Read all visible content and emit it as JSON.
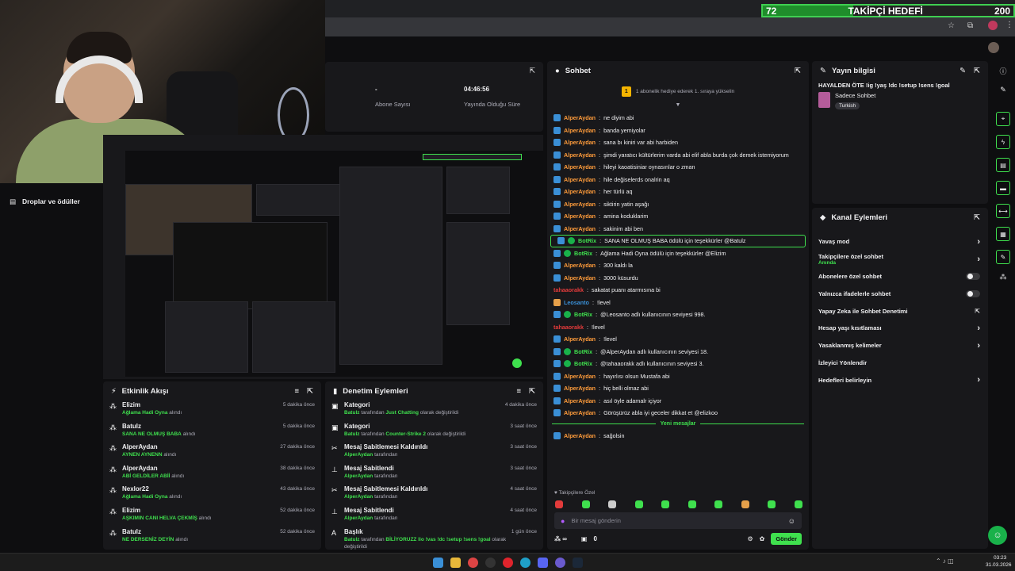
{
  "goal": {
    "current": "72",
    "title": "TAKİPÇİ HEDEFİ",
    "target": "200",
    "progress": 0.36
  },
  "left_nav": {
    "items": [
      {
        "label": "Droplar ve ödüller"
      }
    ]
  },
  "stats": {
    "items": [
      {
        "value": "-",
        "label": "Abone Sayısı"
      },
      {
        "value": "04:46:56",
        "label": "Yayında Olduğu Süre"
      }
    ]
  },
  "activity": {
    "title": "Etkinlik Akışı",
    "items": [
      {
        "name": "Elizim",
        "detail": "Ağlama Hadi Oyna",
        "suffix": "alındı",
        "time": "5 dakika önce"
      },
      {
        "name": "Batulz",
        "detail": "SANA NE OLMUŞ BABA",
        "suffix": "alındı",
        "time": "5 dakika önce"
      },
      {
        "name": "AlperAydan",
        "detail": "AYNEN AYNENN",
        "suffix": "alındı",
        "time": "27 dakika önce"
      },
      {
        "name": "AlperAydan",
        "detail": "ABİ GELDİLER ABİİ",
        "suffix": "alındı",
        "time": "38 dakika önce"
      },
      {
        "name": "Nexlor22",
        "detail": "Ağlama Hadi Oyna",
        "suffix": "alındı",
        "time": "43 dakika önce"
      },
      {
        "name": "Elizim",
        "detail": "AŞKIMIN CANI HELVA ÇEKMİŞ",
        "suffix": "alındı",
        "time": "52 dakika önce"
      },
      {
        "name": "Batulz",
        "detail": "NE DERSENİZ DEYİN",
        "suffix": "alındı",
        "time": "52 dakika önce"
      }
    ]
  },
  "moderation": {
    "title": "Denetim Eylemleri",
    "items": [
      {
        "name": "Kategori",
        "user": "Batulz",
        "mid": "tarafından",
        "detail": "Just Chatting",
        "suffix": "olarak değiştirildi",
        "time": "4 dakika önce",
        "icon": "category-icon"
      },
      {
        "name": "Kategori",
        "user": "Batulz",
        "mid": "tarafından",
        "detail": "Counter-Strike 2",
        "suffix": "olarak değiştirildi",
        "time": "3 saat önce",
        "icon": "category-icon"
      },
      {
        "name": "Mesaj Sabitlemesi Kaldırıldı",
        "user": "AlperAydan",
        "mid": "tarafından",
        "detail": "",
        "suffix": "",
        "time": "3 saat önce",
        "icon": "unpin-icon"
      },
      {
        "name": "Mesaj Sabitlendi",
        "user": "AlperAydan",
        "mid": "tarafından",
        "detail": "",
        "suffix": "",
        "time": "3 saat önce",
        "icon": "pin-icon"
      },
      {
        "name": "Mesaj Sabitlemesi Kaldırıldı",
        "user": "AlperAydan",
        "mid": "tarafından",
        "detail": "",
        "suffix": "",
        "time": "4 saat önce",
        "icon": "unpin-icon"
      },
      {
        "name": "Mesaj Sabitlendi",
        "user": "AlperAydan",
        "mid": "tarafından",
        "detail": "",
        "suffix": "",
        "time": "4 saat önce",
        "icon": "pin-icon"
      },
      {
        "name": "Başlık",
        "user": "Batulz",
        "mid": "tarafından",
        "detail": "BİLİYORUZZ lio !vas !dc !setup !sens !goal",
        "suffix": "olarak değiştirildi",
        "time": "1 gün önce",
        "icon": "title-icon"
      }
    ]
  },
  "chat": {
    "title": "Sohbet",
    "hype": "1 abonelik hediye ederek 1. sıraya yükselin",
    "hype_rank": "1",
    "messages": [
      {
        "user": "AlperAydan",
        "text": "ne diyim abi",
        "color": "#ff9c3b",
        "badge": "mod"
      },
      {
        "user": "AlperAydan",
        "text": "banda yemiyolar",
        "color": "#ff9c3b",
        "badge": "mod"
      },
      {
        "user": "AlperAydan",
        "text": "sana bı kiniri var abi harbiden",
        "color": "#ff9c3b",
        "badge": "mod"
      },
      {
        "user": "AlperAydan",
        "text": "şimdi yaratıcı kültürlerim varda abi elif abla burda çok demek istemiyorum",
        "color": "#ff9c3b",
        "badge": "mod"
      },
      {
        "user": "AlperAydan",
        "text": "hileyi kaoatisiniar oynasınlar o zman",
        "color": "#ff9c3b",
        "badge": "mod"
      },
      {
        "user": "AlperAydan",
        "text": "hile değiselerds onalrin aq",
        "color": "#ff9c3b",
        "badge": "mod"
      },
      {
        "user": "AlperAydan",
        "text": "her türlü aq",
        "color": "#ff9c3b",
        "badge": "mod"
      },
      {
        "user": "AlperAydan",
        "text": "siktirin yatin aşağı",
        "color": "#ff9c3b",
        "badge": "mod"
      },
      {
        "user": "AlperAydan",
        "text": "amina koduklarim",
        "color": "#ff9c3b",
        "badge": "mod"
      },
      {
        "user": "AlperAydan",
        "text": "sakinim abi ben",
        "color": "#ff9c3b",
        "badge": "mod"
      },
      {
        "user": "BotRix",
        "text": "SANA NE OLMUŞ BABA ödülü için teşekkürler @Batulz",
        "color": "#3fe04e",
        "badge": "bot",
        "highlight": true
      },
      {
        "user": "BotRix",
        "text": "Ağlama Hadi Oyna ödülü için teşekkürler @Elizim",
        "color": "#3fe04e",
        "badge": "bot"
      },
      {
        "user": "AlperAydan",
        "text": "300 kaldı la",
        "color": "#ff9c3b",
        "badge": "mod"
      },
      {
        "user": "AlperAydan",
        "text": "3000 küsurdu",
        "color": "#ff9c3b",
        "badge": "mod"
      },
      {
        "user": "tahaaorakk",
        "text": "sakatat puanı atarmısına bi",
        "color": "#e33b3b",
        "badge": ""
      },
      {
        "user": "Leosanto",
        "text": "!level",
        "color": "#3a8fd6",
        "badge": "crown"
      },
      {
        "user": "BotRix",
        "text": "@Leosanto adlı kullanıcının seviyesi 998.",
        "color": "#3fe04e",
        "badge": "bot"
      },
      {
        "user": "tahaaorakk",
        "text": "!level",
        "color": "#e33b3b",
        "badge": ""
      },
      {
        "user": "AlperAydan",
        "text": "!level",
        "color": "#ff9c3b",
        "badge": "mod"
      },
      {
        "user": "BotRix",
        "text": "@AlperAydan adlı kullanıcının seviyesi 18.",
        "color": "#3fe04e",
        "badge": "bot"
      },
      {
        "user": "BotRix",
        "text": "@tahaaorakk adlı kullanıcının seviyesi 3.",
        "color": "#3fe04e",
        "badge": "bot"
      },
      {
        "user": "AlperAydan",
        "text": "hayırlısı olsun Mustafa abi",
        "color": "#ff9c3b",
        "badge": "mod"
      },
      {
        "user": "AlperAydan",
        "text": "hiç belli olmaz abi",
        "color": "#ff9c3b",
        "badge": "mod"
      },
      {
        "user": "AlperAydan",
        "text": "asıl öyle adamalr içiyor",
        "color": "#ff9c3b",
        "badge": "mod"
      },
      {
        "user": "AlperAydan",
        "text": "Görüşürüz abla iyi geceler dikkat et @elizkoo",
        "color": "#ff9c3b",
        "badge": "mod"
      }
    ],
    "new_messages": "Yeni mesajlar",
    "after": [
      {
        "user": "AlperAydan",
        "text": "sağolsin",
        "color": "#ff9c3b",
        "badge": "mod"
      }
    ],
    "followers_only": "Takipçilere Özel",
    "input_placeholder": "Bir mesaj gönderin",
    "points": "∞",
    "gift_count": "0",
    "send_label": "Gönder"
  },
  "stream_info": {
    "title": "Yayın bilgisi",
    "stream_title": "HAYALDEN ÖTE !ig !yaş !dc !setup !sens !goal",
    "category": "Sadece Sohbet",
    "tag": "Turkish"
  },
  "channel_actions": {
    "title": "Kanal Eylemleri",
    "items": [
      {
        "label": "Yavaş mod",
        "sub": "",
        "control": "chevron"
      },
      {
        "label": "Takipçilere özel sohbet",
        "sub": "Anında",
        "control": "chevron"
      },
      {
        "label": "Abonelere özel sohbet",
        "sub": "",
        "control": "toggle"
      },
      {
        "label": "Yalnızca ifadelerle sohbet",
        "sub": "",
        "control": "toggle"
      },
      {
        "label": "Yapay Zeka ile Sohbet Denetimi",
        "sub": "",
        "control": "external"
      },
      {
        "label": "Hesap yaşı kısıtlaması",
        "sub": "",
        "control": "chevron"
      },
      {
        "label": "Yasaklanmış kelimeler",
        "sub": "",
        "control": "chevron"
      },
      {
        "label": "İzleyici Yönlendir",
        "sub": "",
        "control": ""
      },
      {
        "label": "Hedefleri belirleyin",
        "sub": "",
        "control": "chevron"
      }
    ]
  },
  "taskbar": {
    "time": "03:23",
    "date": "31.03.2026"
  },
  "colors": {
    "accent": "#3fe04e",
    "bg": "#0e0e10",
    "panel": "#18181b"
  }
}
